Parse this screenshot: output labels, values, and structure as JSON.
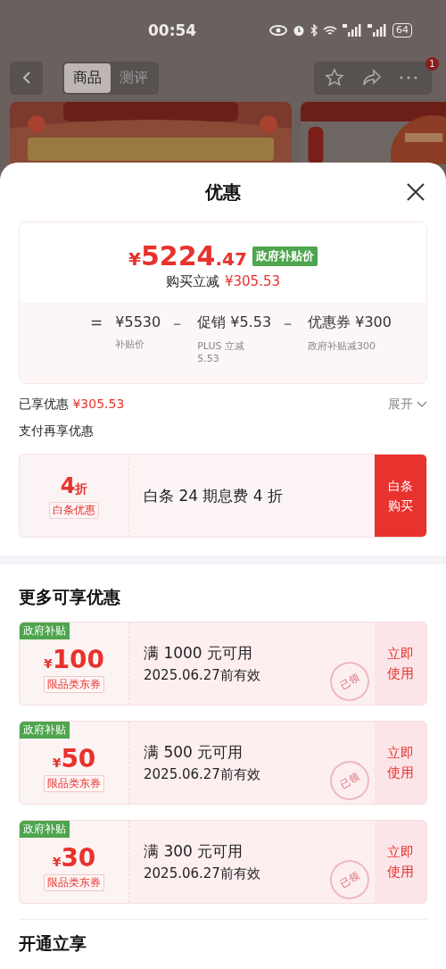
{
  "status_bar": {
    "time": "00:54",
    "battery": "64"
  },
  "nav": {
    "tabs": [
      {
        "label": "商品",
        "selected": true
      },
      {
        "label": "测评",
        "selected": false
      }
    ],
    "badge": "1"
  },
  "sheet": {
    "title": "优惠",
    "price": {
      "currency": "¥",
      "main": "5224",
      "decimal": ".47",
      "tag": "政府补贴价",
      "cut_label": "购买立减",
      "cut_amount": "¥305.53"
    },
    "breakdown": [
      {
        "op": "=",
        "value": "¥5530",
        "note": "补贴价"
      },
      {
        "op": "－",
        "value": "促销 ¥5.53",
        "note": "PLUS 立减 5.53"
      },
      {
        "op": "－",
        "value": "优惠券 ¥300",
        "note": "政府补贴减300"
      }
    ],
    "enjoyed": {
      "label": "已享优惠",
      "amount": "¥305.53",
      "toggle": "展开"
    },
    "pay_section": {
      "title": "支付再享优惠",
      "offer": {
        "discount": "4",
        "unit": "折",
        "tag": "白条优惠",
        "text": "白条 24 期息费 4 折",
        "button": "白条购买"
      }
    },
    "more": {
      "title": "更多可享优惠",
      "coupons": [
        {
          "badge": "政府补贴",
          "currency": "¥",
          "amount": "100",
          "tag": "限品类东券",
          "condition": "满 1000 元可用",
          "validity": "2025.06.27前有效",
          "button": "立即使用",
          "stamp": "已领"
        },
        {
          "badge": "政府补贴",
          "currency": "¥",
          "amount": "50",
          "tag": "限品类东券",
          "condition": "满 500 元可用",
          "validity": "2025.06.27前有效",
          "button": "立即使用",
          "stamp": "已领"
        },
        {
          "badge": "政府补贴",
          "currency": "¥",
          "amount": "30",
          "tag": "限品类东券",
          "condition": "满 300 元可用",
          "validity": "2025.06.27前有效",
          "button": "立即使用",
          "stamp": "已领"
        }
      ]
    },
    "next_title": "开通立享"
  }
}
